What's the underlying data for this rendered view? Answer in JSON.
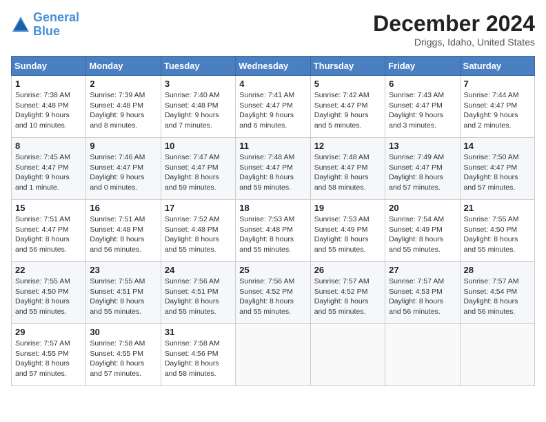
{
  "header": {
    "logo_line1": "General",
    "logo_line2": "Blue",
    "title": "December 2024",
    "location": "Driggs, Idaho, United States"
  },
  "weekdays": [
    "Sunday",
    "Monday",
    "Tuesday",
    "Wednesday",
    "Thursday",
    "Friday",
    "Saturday"
  ],
  "weeks": [
    [
      {
        "day": "1",
        "sunrise": "Sunrise: 7:38 AM",
        "sunset": "Sunset: 4:48 PM",
        "daylight": "Daylight: 9 hours and 10 minutes."
      },
      {
        "day": "2",
        "sunrise": "Sunrise: 7:39 AM",
        "sunset": "Sunset: 4:48 PM",
        "daylight": "Daylight: 9 hours and 8 minutes."
      },
      {
        "day": "3",
        "sunrise": "Sunrise: 7:40 AM",
        "sunset": "Sunset: 4:48 PM",
        "daylight": "Daylight: 9 hours and 7 minutes."
      },
      {
        "day": "4",
        "sunrise": "Sunrise: 7:41 AM",
        "sunset": "Sunset: 4:47 PM",
        "daylight": "Daylight: 9 hours and 6 minutes."
      },
      {
        "day": "5",
        "sunrise": "Sunrise: 7:42 AM",
        "sunset": "Sunset: 4:47 PM",
        "daylight": "Daylight: 9 hours and 5 minutes."
      },
      {
        "day": "6",
        "sunrise": "Sunrise: 7:43 AM",
        "sunset": "Sunset: 4:47 PM",
        "daylight": "Daylight: 9 hours and 3 minutes."
      },
      {
        "day": "7",
        "sunrise": "Sunrise: 7:44 AM",
        "sunset": "Sunset: 4:47 PM",
        "daylight": "Daylight: 9 hours and 2 minutes."
      }
    ],
    [
      {
        "day": "8",
        "sunrise": "Sunrise: 7:45 AM",
        "sunset": "Sunset: 4:47 PM",
        "daylight": "Daylight: 9 hours and 1 minute."
      },
      {
        "day": "9",
        "sunrise": "Sunrise: 7:46 AM",
        "sunset": "Sunset: 4:47 PM",
        "daylight": "Daylight: 9 hours and 0 minutes."
      },
      {
        "day": "10",
        "sunrise": "Sunrise: 7:47 AM",
        "sunset": "Sunset: 4:47 PM",
        "daylight": "Daylight: 8 hours and 59 minutes."
      },
      {
        "day": "11",
        "sunrise": "Sunrise: 7:48 AM",
        "sunset": "Sunset: 4:47 PM",
        "daylight": "Daylight: 8 hours and 59 minutes."
      },
      {
        "day": "12",
        "sunrise": "Sunrise: 7:48 AM",
        "sunset": "Sunset: 4:47 PM",
        "daylight": "Daylight: 8 hours and 58 minutes."
      },
      {
        "day": "13",
        "sunrise": "Sunrise: 7:49 AM",
        "sunset": "Sunset: 4:47 PM",
        "daylight": "Daylight: 8 hours and 57 minutes."
      },
      {
        "day": "14",
        "sunrise": "Sunrise: 7:50 AM",
        "sunset": "Sunset: 4:47 PM",
        "daylight": "Daylight: 8 hours and 57 minutes."
      }
    ],
    [
      {
        "day": "15",
        "sunrise": "Sunrise: 7:51 AM",
        "sunset": "Sunset: 4:47 PM",
        "daylight": "Daylight: 8 hours and 56 minutes."
      },
      {
        "day": "16",
        "sunrise": "Sunrise: 7:51 AM",
        "sunset": "Sunset: 4:48 PM",
        "daylight": "Daylight: 8 hours and 56 minutes."
      },
      {
        "day": "17",
        "sunrise": "Sunrise: 7:52 AM",
        "sunset": "Sunset: 4:48 PM",
        "daylight": "Daylight: 8 hours and 55 minutes."
      },
      {
        "day": "18",
        "sunrise": "Sunrise: 7:53 AM",
        "sunset": "Sunset: 4:48 PM",
        "daylight": "Daylight: 8 hours and 55 minutes."
      },
      {
        "day": "19",
        "sunrise": "Sunrise: 7:53 AM",
        "sunset": "Sunset: 4:49 PM",
        "daylight": "Daylight: 8 hours and 55 minutes."
      },
      {
        "day": "20",
        "sunrise": "Sunrise: 7:54 AM",
        "sunset": "Sunset: 4:49 PM",
        "daylight": "Daylight: 8 hours and 55 minutes."
      },
      {
        "day": "21",
        "sunrise": "Sunrise: 7:55 AM",
        "sunset": "Sunset: 4:50 PM",
        "daylight": "Daylight: 8 hours and 55 minutes."
      }
    ],
    [
      {
        "day": "22",
        "sunrise": "Sunrise: 7:55 AM",
        "sunset": "Sunset: 4:50 PM",
        "daylight": "Daylight: 8 hours and 55 minutes."
      },
      {
        "day": "23",
        "sunrise": "Sunrise: 7:55 AM",
        "sunset": "Sunset: 4:51 PM",
        "daylight": "Daylight: 8 hours and 55 minutes."
      },
      {
        "day": "24",
        "sunrise": "Sunrise: 7:56 AM",
        "sunset": "Sunset: 4:51 PM",
        "daylight": "Daylight: 8 hours and 55 minutes."
      },
      {
        "day": "25",
        "sunrise": "Sunrise: 7:56 AM",
        "sunset": "Sunset: 4:52 PM",
        "daylight": "Daylight: 8 hours and 55 minutes."
      },
      {
        "day": "26",
        "sunrise": "Sunrise: 7:57 AM",
        "sunset": "Sunset: 4:52 PM",
        "daylight": "Daylight: 8 hours and 55 minutes."
      },
      {
        "day": "27",
        "sunrise": "Sunrise: 7:57 AM",
        "sunset": "Sunset: 4:53 PM",
        "daylight": "Daylight: 8 hours and 56 minutes."
      },
      {
        "day": "28",
        "sunrise": "Sunrise: 7:57 AM",
        "sunset": "Sunset: 4:54 PM",
        "daylight": "Daylight: 8 hours and 56 minutes."
      }
    ],
    [
      {
        "day": "29",
        "sunrise": "Sunrise: 7:57 AM",
        "sunset": "Sunset: 4:55 PM",
        "daylight": "Daylight: 8 hours and 57 minutes."
      },
      {
        "day": "30",
        "sunrise": "Sunrise: 7:58 AM",
        "sunset": "Sunset: 4:55 PM",
        "daylight": "Daylight: 8 hours and 57 minutes."
      },
      {
        "day": "31",
        "sunrise": "Sunrise: 7:58 AM",
        "sunset": "Sunset: 4:56 PM",
        "daylight": "Daylight: 8 hours and 58 minutes."
      },
      null,
      null,
      null,
      null
    ]
  ]
}
